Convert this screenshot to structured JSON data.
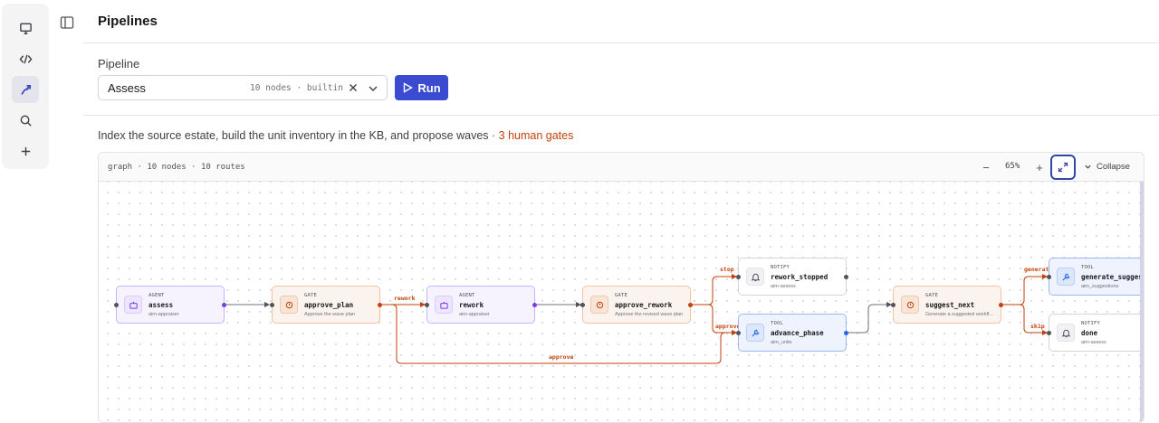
{
  "rail": {
    "items": [
      {
        "icon": "monitor-icon",
        "active": false
      },
      {
        "icon": "code-icon",
        "active": false
      },
      {
        "icon": "pipelines-icon",
        "active": true
      },
      {
        "icon": "search-icon",
        "active": false
      },
      {
        "icon": "plus-icon",
        "active": false
      }
    ]
  },
  "header": {
    "title": "Pipelines",
    "toggle_icon": "sidebar-toggle-icon"
  },
  "pipeline": {
    "label": "Pipeline",
    "selected": "Assess",
    "meta": "10 nodes · builtin",
    "run_label": "Run"
  },
  "description": {
    "text": "Index the source estate, build the unit inventory in the KB, and propose waves",
    "gates": " · 3 human gates"
  },
  "graph": {
    "info": "graph · 10 nodes · 10 routes",
    "zoom_out": "−",
    "zoom": "65%",
    "zoom_in": "+",
    "collapse_label": "Collapse",
    "colors": {
      "agent": "#7c3aed",
      "gate": "#c2410c",
      "tool": "#2563eb",
      "edge_default": "#52525b"
    },
    "nodes": [
      {
        "id": "assess",
        "type": "AGENT",
        "kind": "agent",
        "name": "assess",
        "sub": "aim-appraiser",
        "icon": "robot-icon"
      },
      {
        "id": "approve_plan",
        "type": "GATE",
        "kind": "gate",
        "name": "approve_plan",
        "sub": "Approve the wave plan",
        "icon": "hand-icon"
      },
      {
        "id": "rework",
        "type": "AGENT",
        "kind": "agent",
        "name": "rework",
        "sub": "aim-appraiser",
        "icon": "robot-icon"
      },
      {
        "id": "approve_rework",
        "type": "GATE",
        "kind": "gate",
        "name": "approve_rework",
        "sub": "Approve the revised wave plan",
        "icon": "hand-icon"
      },
      {
        "id": "rework_stopped",
        "type": "NOTIFY",
        "kind": "notify",
        "name": "rework_stopped",
        "sub": "aim-assess",
        "icon": "bell-icon"
      },
      {
        "id": "advance_phase",
        "type": "TOOL",
        "kind": "tool",
        "name": "advance_phase",
        "sub": "aim_units",
        "icon": "wrench-icon"
      },
      {
        "id": "suggest_next",
        "type": "GATE",
        "kind": "gate",
        "name": "suggest_next",
        "sub": "Generate a suggested workfl...",
        "icon": "hand-icon"
      },
      {
        "id": "generate_suggest",
        "type": "TOOL",
        "kind": "tool",
        "name": "generate_suggest",
        "sub": "aim_suggestions",
        "icon": "wrench-icon"
      },
      {
        "id": "done",
        "type": "NOTIFY",
        "kind": "notify",
        "name": "done",
        "sub": "aim-assess",
        "icon": "bell-icon"
      }
    ],
    "edge_labels": {
      "rework": "rework",
      "approve": "approve",
      "stop": "stop",
      "approve_short": "approve",
      "generate": "generate",
      "skip": "skip"
    }
  }
}
